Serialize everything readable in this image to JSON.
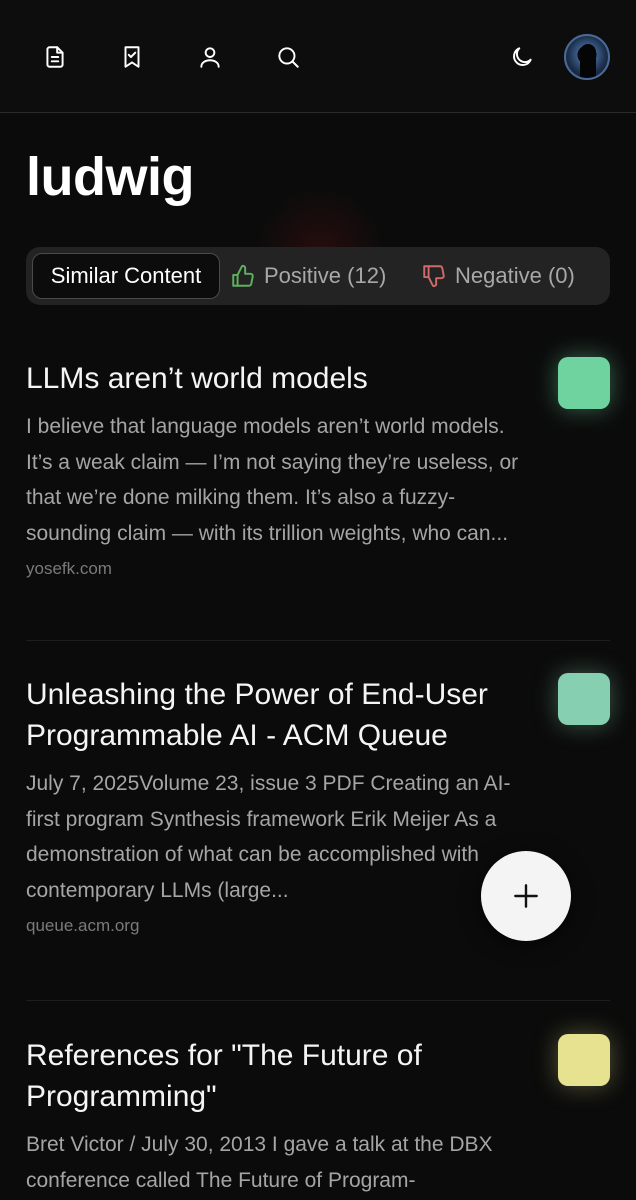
{
  "header": {
    "nav_icons": [
      "document-icon",
      "bookmark-check-icon",
      "user-icon",
      "search-icon"
    ],
    "theme_icon": "moon-icon",
    "avatar": "avatar"
  },
  "page": {
    "title": "ludwig"
  },
  "filters": {
    "similar": "Similar Content",
    "positive": "Positive (12)",
    "negative": "Negative (0)",
    "positive_color": "#5fb05f",
    "negative_color": "#d06a6a"
  },
  "items": [
    {
      "title": "LLMs aren’t world models",
      "excerpt": "I believe that language models aren’t world models. It’s a weak claim — I’m not saying they’re useless, or that we’re done milking them. It’s also a fuzzy-sounding claim — with its trillion weights, who can...",
      "source": "yosefk.com",
      "thumb_color": "#6fd3a0"
    },
    {
      "title": "Unleashing the Power of End-User Programmable AI - ACM Queue",
      "excerpt": "July 7, 2025Volume 23, issue 3 PDF Creating an AI-first program Synthesis framework Erik Meijer As a demonstration of what can be accomplished with contemporary LLMs (large...",
      "source": "queue.acm.org",
      "thumb_color": "#86cfb0"
    },
    {
      "title": "References for \"The Future of Programming\"",
      "excerpt": "Bret Victor / July 30, 2013 I gave a talk at the DBX conference called The Future of Program-",
      "source": "",
      "thumb_color": "#e6e290"
    }
  ],
  "fab": {
    "icon": "plus-icon"
  }
}
